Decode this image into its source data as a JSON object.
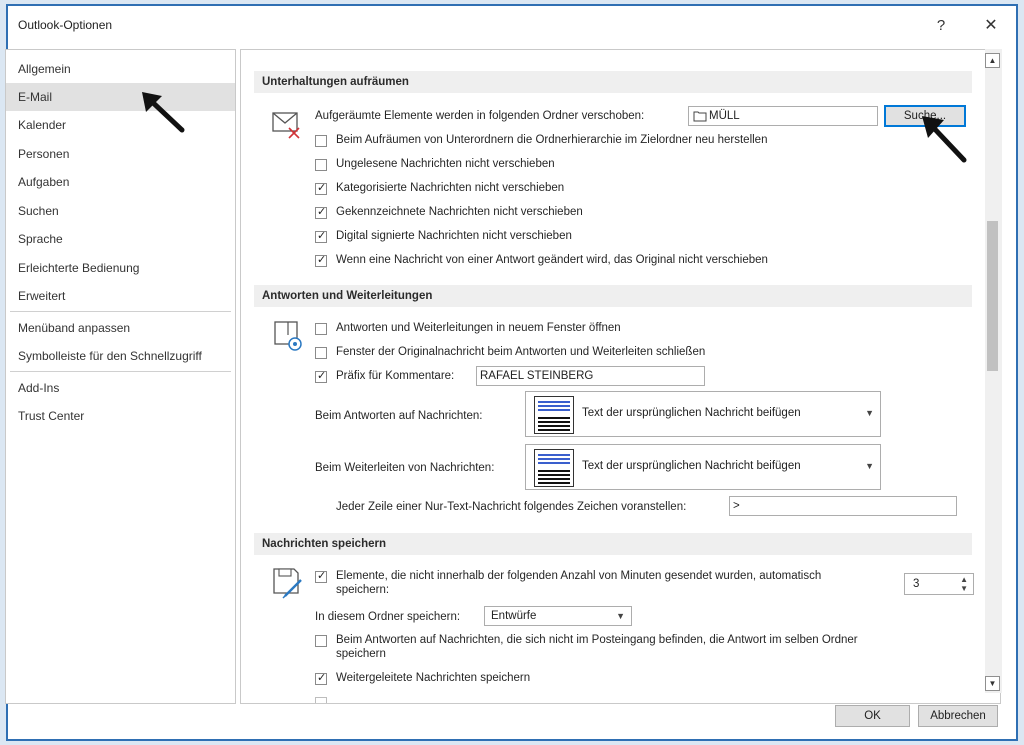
{
  "window": {
    "title": "Outlook-Optionen",
    "help_glyph": "?",
    "close_glyph": "✕"
  },
  "sidebar": {
    "items": [
      {
        "label": "Allgemein"
      },
      {
        "label": "E-Mail",
        "selected": true
      },
      {
        "label": "Kalender"
      },
      {
        "label": "Personen"
      },
      {
        "label": "Aufgaben"
      },
      {
        "label": "Suchen"
      },
      {
        "label": "Sprache"
      },
      {
        "label": "Erleichterte Bedienung"
      },
      {
        "label": "Erweitert"
      },
      {
        "label": "Menüband anpassen"
      },
      {
        "label": "Symbolleiste für den Schnellzugriff"
      },
      {
        "label": "Add-Ins"
      },
      {
        "label": "Trust Center"
      }
    ]
  },
  "cleanup": {
    "header": "Unterhaltungen aufräumen",
    "move_label": "Aufgeräumte Elemente werden in folgenden Ordner verschoben:",
    "folder_value": "MÜLL",
    "browse_label": "Suche...",
    "options": [
      {
        "label": "Beim Aufräumen von Unterordnern die Ordnerhierarchie im Zielordner neu herstellen",
        "checked": false
      },
      {
        "label": "Ungelesene Nachrichten nicht verschieben",
        "checked": false
      },
      {
        "label": "Kategorisierte Nachrichten nicht verschieben",
        "checked": true
      },
      {
        "label": "Gekennzeichnete Nachrichten nicht verschieben",
        "checked": true
      },
      {
        "label": "Digital signierte Nachrichten nicht verschieben",
        "checked": true
      },
      {
        "label": "Wenn eine Nachricht von einer Antwort geändert wird, das Original nicht verschieben",
        "checked": true
      }
    ]
  },
  "replies": {
    "header": "Antworten und Weiterleitungen",
    "open_new_window": {
      "label": "Antworten und Weiterleitungen in neuem Fenster öffnen",
      "checked": false
    },
    "close_original": {
      "label": "Fenster der Originalnachricht beim Antworten und Weiterleiten schließen",
      "checked": false
    },
    "prefix": {
      "label": "Präfix für Kommentare:",
      "checked": true,
      "value": "RAFAEL STEINBERG"
    },
    "reply_label": "Beim Antworten auf Nachrichten:",
    "reply_value": "Text der ursprünglichen Nachricht beifügen",
    "forward_label": "Beim Weiterleiten von Nachrichten:",
    "forward_value": "Text der ursprünglichen Nachricht beifügen",
    "prefix_char_label": "Jeder Zeile einer Nur-Text-Nachricht folgendes Zeichen voranstellen:",
    "prefix_char_value": ">"
  },
  "save": {
    "header": "Nachrichten speichern",
    "autosave": {
      "label_line1": "Elemente, die nicht innerhalb der folgenden Anzahl von Minuten gesendet wurden, automatisch",
      "label_line2": "speichern:",
      "checked": true,
      "minutes": "3"
    },
    "folder_label": "In diesem Ordner speichern:",
    "folder_value": "Entwürfe",
    "reply_same_folder": {
      "label_line1": "Beim Antworten auf Nachrichten, die sich nicht im Posteingang befinden, die Antwort im selben Ordner",
      "label_line2": "speichern",
      "checked": false
    },
    "save_forwarded": {
      "label": "Weitergeleitete Nachrichten speichern",
      "checked": true
    }
  },
  "footer": {
    "ok_label": "OK",
    "cancel_label": "Abbrechen"
  }
}
